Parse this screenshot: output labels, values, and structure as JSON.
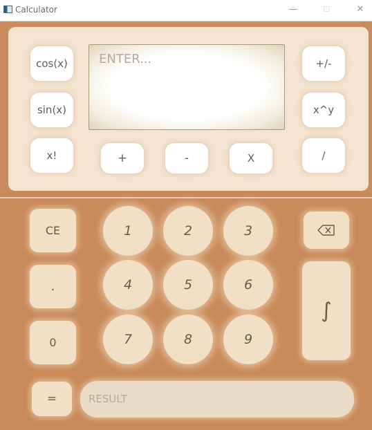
{
  "window": {
    "title": "Calculator",
    "minimize_glyph": "—",
    "maximize_glyph": "☐",
    "close_glyph": "✕"
  },
  "functions": {
    "cos": "cos(x)",
    "sin": "sin(x)",
    "factorial": "x!",
    "sign": "+/-",
    "power": "x^y",
    "add": "+",
    "subtract": "-",
    "multiply": "X",
    "divide": "/"
  },
  "input": {
    "placeholder": "ENTER..."
  },
  "keys": {
    "clear": "CE",
    "decimal": ".",
    "zero": "0",
    "equals": "=",
    "integral": "∫",
    "backspace_icon": "backspace-icon"
  },
  "digits": [
    "1",
    "2",
    "3",
    "4",
    "5",
    "6",
    "7",
    "8",
    "9"
  ],
  "result": {
    "placeholder": "RESULT"
  },
  "colors": {
    "background": "#c98b5b",
    "panel": "#f3e3cf",
    "key": "#f1dfc6",
    "text": "#6a5a4e"
  }
}
